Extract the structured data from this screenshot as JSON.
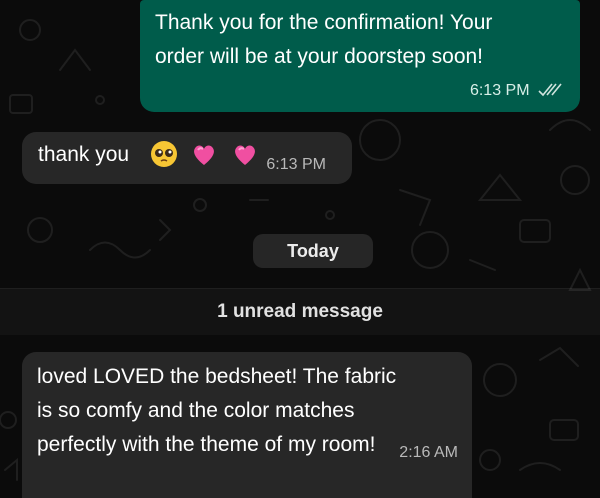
{
  "messages": [
    {
      "direction": "outgoing",
      "text_lines": [
        "Thank you for the confirmation! Your",
        "order will be at your doorstep soon!"
      ],
      "time": "6:13 PM",
      "status": "double-check-read"
    },
    {
      "direction": "incoming",
      "text": "thank you",
      "emojis": [
        "pleading-face-emoji",
        "pink-heart-emoji",
        "pink-heart-emoji"
      ],
      "time": "6:13 PM"
    },
    {
      "direction": "incoming",
      "text_lines": [
        "loved LOVED the bedsheet! The fabric",
        "is so comfy and the color matches",
        "perfectly with the theme of my room!"
      ],
      "time": "2:16 AM"
    }
  ],
  "date_separator": "Today",
  "unread_banner": "1 unread message",
  "colors": {
    "background": "#0b0b0b",
    "outgoing_bubble": "#005c4b",
    "incoming_bubble": "#272727"
  }
}
